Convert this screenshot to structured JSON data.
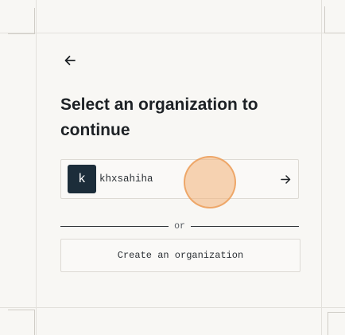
{
  "page": {
    "title": "Select an organization to continue"
  },
  "back": {
    "icon": "arrow-left-icon"
  },
  "organizations": [
    {
      "initial": "k",
      "name": "khxsahiha",
      "avatar_color": "#1c2d3a",
      "action_icon": "arrow-right-icon"
    }
  ],
  "divider": {
    "label": "or"
  },
  "create_button": {
    "label": "Create an organization"
  },
  "colors": {
    "background": "#f8f7f4",
    "text": "#1d2125",
    "border": "#dddad4",
    "cursor_highlight": "#f2b278"
  }
}
